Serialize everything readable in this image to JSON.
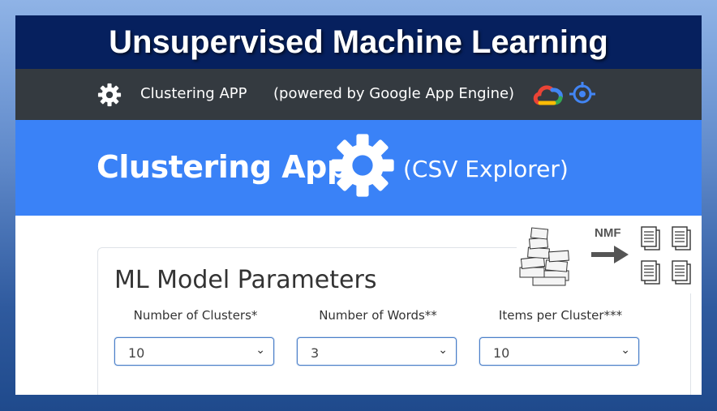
{
  "banner": {
    "title": "Unsupervised Machine Learning"
  },
  "navbar": {
    "icon": "gear-icon",
    "title": "Clustering APP",
    "powered_by": "(powered by Google App Engine)",
    "logos": [
      "google-cloud-icon",
      "app-engine-icon"
    ]
  },
  "hero": {
    "title": "Clustering App",
    "icon": "gear-icon",
    "subtitle": "(CSV Explorer)"
  },
  "illustration": {
    "label": "NMF"
  },
  "params": {
    "heading": "ML Model Parameters",
    "fields": [
      {
        "label": "Number of Clusters*",
        "value": "10"
      },
      {
        "label": "Number of Words**",
        "value": "3"
      },
      {
        "label": "Items per Cluster***",
        "value": "10"
      }
    ]
  },
  "colors": {
    "banner": "#06205e",
    "navbar": "#343a40",
    "hero": "#3a82f7",
    "select_border": "#4a7fc9"
  }
}
